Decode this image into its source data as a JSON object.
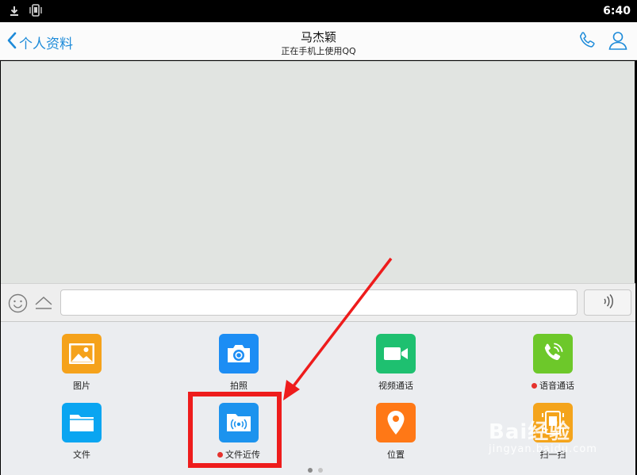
{
  "status_bar": {
    "time": "6:40"
  },
  "header": {
    "back_label": "个人资料",
    "title": "马杰颖",
    "subtitle": "正在手机上使用QQ"
  },
  "input": {
    "value": "",
    "placeholder": ""
  },
  "panel": {
    "tiles": [
      {
        "label": "图片",
        "icon": "image-icon",
        "color": "#f5a21b",
        "dot": false
      },
      {
        "label": "拍照",
        "icon": "camera-icon",
        "color": "#1c8df4",
        "dot": false
      },
      {
        "label": "视频通话",
        "icon": "video-call-icon",
        "color": "#1ec070",
        "dot": false
      },
      {
        "label": "语音通话",
        "icon": "voice-call-icon",
        "color": "#6dc82a",
        "dot": true
      },
      {
        "label": "文件",
        "icon": "folder-icon",
        "color": "#0aa5f1",
        "dot": false
      },
      {
        "label": "文件近传",
        "icon": "nearby-file-icon",
        "color": "#1c93ee",
        "dot": true
      },
      {
        "label": "位置",
        "icon": "location-pin-icon",
        "color": "#ff7816",
        "dot": false
      },
      {
        "label": "扫一扫",
        "icon": "scan-icon",
        "color": "#f4a41c",
        "dot": false
      }
    ],
    "page_count": 2,
    "current_page": 1
  },
  "annotation": {
    "highlight_color": "#ee1c1c"
  },
  "watermark": {
    "logo": "Bai经验",
    "url": "jingyan.baidu.com"
  }
}
